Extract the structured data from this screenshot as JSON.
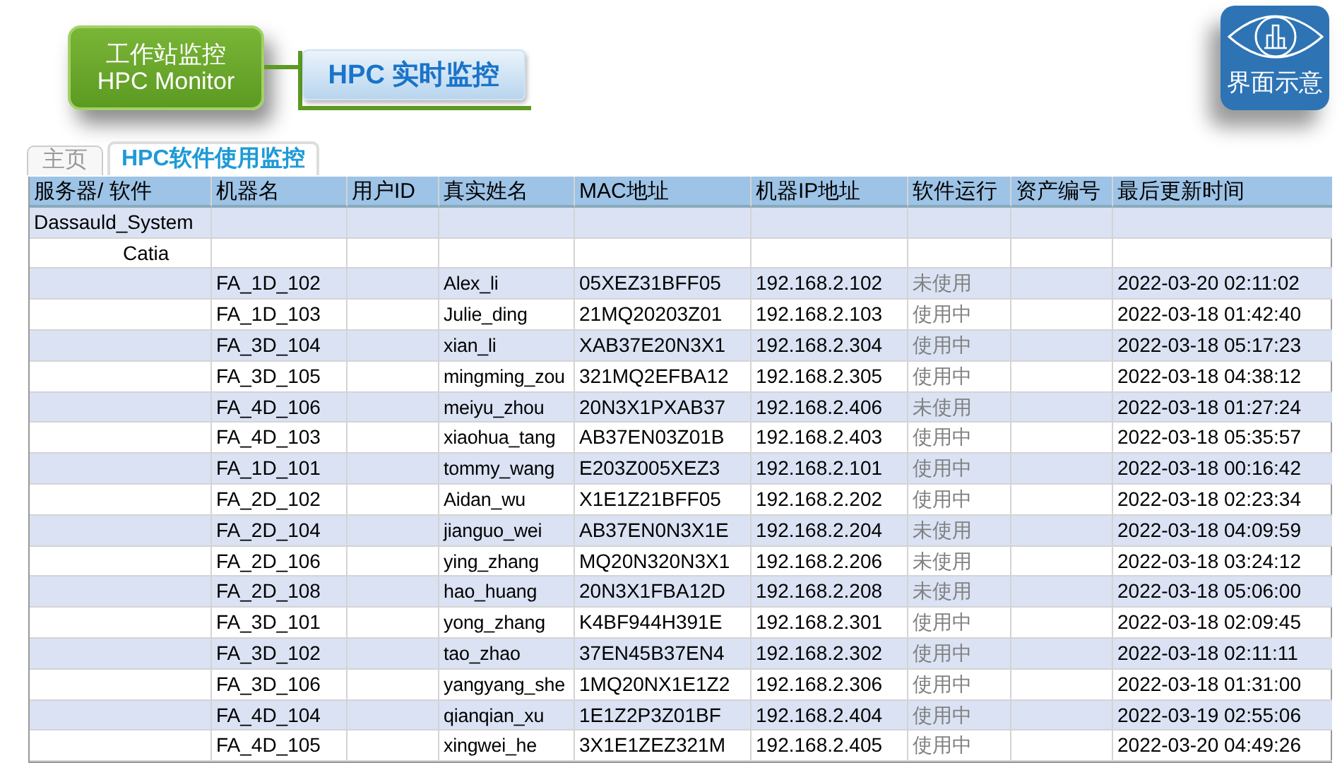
{
  "header": {
    "node_title": "工作站监控",
    "node_subtitle": "HPC Monitor",
    "realtime_button": "HPC 实时监控",
    "badge": "界面示意"
  },
  "tabs": [
    {
      "label": "主页",
      "selected": false
    },
    {
      "label": "HPC软件使用监控",
      "selected": true
    }
  ],
  "table": {
    "columns": [
      "服务器/ 软件",
      "机器名",
      "用户ID",
      "真实姓名",
      "MAC地址",
      "机器IP地址",
      "软件运行",
      "资产编号",
      "最后更新时间"
    ],
    "rows": [
      {
        "kind": "vendor",
        "label": "Dassauld_System"
      },
      {
        "kind": "software",
        "label": "Catia"
      },
      {
        "kind": "machine",
        "machine": "FA_1D_102",
        "real_name": "Alex_li",
        "mac": "05XEZ31BFF05",
        "ip": "192.168.2.102",
        "status": "未使用",
        "updated": "2022-03-20 02:11:02"
      },
      {
        "kind": "machine",
        "machine": "FA_1D_103",
        "real_name": "Julie_ding",
        "mac": "21MQ20203Z01",
        "ip": "192.168.2.103",
        "status": "使用中",
        "updated": "2022-03-18 01:42:40"
      },
      {
        "kind": "machine",
        "machine": "FA_3D_104",
        "real_name": "xian_li",
        "mac": "XAB37E20N3X1",
        "ip": "192.168.2.304",
        "status": "使用中",
        "updated": "2022-03-18 05:17:23"
      },
      {
        "kind": "machine",
        "machine": "FA_3D_105",
        "real_name": "mingming_zou",
        "mac": "321MQ2EFBA12",
        "ip": "192.168.2.305",
        "status": "使用中",
        "updated": "2022-03-18 04:38:12"
      },
      {
        "kind": "machine",
        "machine": "FA_4D_106",
        "real_name": "meiyu_zhou",
        "mac": "20N3X1PXAB37",
        "ip": "192.168.2.406",
        "status": "未使用",
        "updated": "2022-03-18 01:27:24"
      },
      {
        "kind": "machine",
        "machine": "FA_4D_103",
        "real_name": "xiaohua_tang",
        "mac": "AB37EN03Z01B",
        "ip": "192.168.2.403",
        "status": "使用中",
        "updated": "2022-03-18 05:35:57"
      },
      {
        "kind": "machine",
        "machine": "FA_1D_101",
        "real_name": "tommy_wang",
        "mac": "E203Z005XEZ3",
        "ip": "192.168.2.101",
        "status": "使用中",
        "updated": "2022-03-18 00:16:42"
      },
      {
        "kind": "machine",
        "machine": "FA_2D_102",
        "real_name": "Aidan_wu",
        "mac": "X1E1Z21BFF05",
        "ip": "192.168.2.202",
        "status": "使用中",
        "updated": "2022-03-18 02:23:34"
      },
      {
        "kind": "machine",
        "machine": "FA_2D_104",
        "real_name": "jianguo_wei",
        "mac": "AB37EN0N3X1E",
        "ip": "192.168.2.204",
        "status": "未使用",
        "updated": "2022-03-18 04:09:59"
      },
      {
        "kind": "machine",
        "machine": "FA_2D_106",
        "real_name": "ying_zhang",
        "mac": "MQ20N320N3X1",
        "ip": "192.168.2.206",
        "status": "未使用",
        "updated": "2022-03-18 03:24:12"
      },
      {
        "kind": "machine",
        "machine": "FA_2D_108",
        "real_name": "hao_huang",
        "mac": "20N3X1FBA12D",
        "ip": "192.168.2.208",
        "status": "未使用",
        "updated": "2022-03-18 05:06:00"
      },
      {
        "kind": "machine",
        "machine": "FA_3D_101",
        "real_name": "yong_zhang",
        "mac": "K4BF944H391E",
        "ip": "192.168.2.301",
        "status": "使用中",
        "updated": "2022-03-18 02:09:45"
      },
      {
        "kind": "machine",
        "machine": "FA_3D_102",
        "real_name": "tao_zhao",
        "mac": "37EN45B37EN4",
        "ip": "192.168.2.302",
        "status": "使用中",
        "updated": "2022-03-18 02:11:11"
      },
      {
        "kind": "machine",
        "machine": "FA_3D_106",
        "real_name": "yangyang_she",
        "mac": "1MQ20NX1E1Z2",
        "ip": "192.168.2.306",
        "status": "使用中",
        "updated": "2022-03-18 01:31:00"
      },
      {
        "kind": "machine",
        "machine": "FA_4D_104",
        "real_name": "qianqian_xu",
        "mac": "1E1Z2P3Z01BF",
        "ip": "192.168.2.404",
        "status": "使用中",
        "updated": "2022-03-19 02:55:06"
      },
      {
        "kind": "machine",
        "machine": "FA_4D_105",
        "real_name": "xingwei_he",
        "mac": "3X1E1ZEZ321M",
        "ip": "192.168.2.405",
        "status": "使用中",
        "updated": "2022-03-20 04:49:26"
      }
    ]
  }
}
